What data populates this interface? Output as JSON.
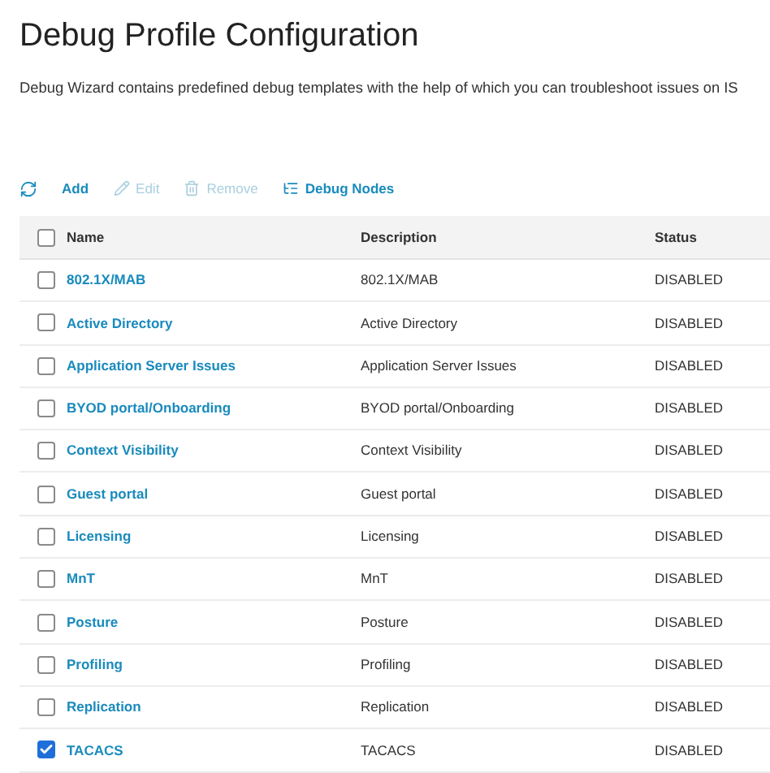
{
  "title": "Debug Profile Configuration",
  "description": "Debug Wizard contains predefined debug templates with the help of which you can troubleshoot issues on IS",
  "toolbar": [
    {
      "kind": "refresh",
      "disabled": false
    },
    {
      "kind": "add",
      "label": "Add",
      "disabled": false
    },
    {
      "kind": "edit",
      "label": "Edit",
      "disabled": true
    },
    {
      "kind": "remove",
      "label": "Remove",
      "disabled": true
    },
    {
      "kind": "nodes",
      "label": "Debug Nodes",
      "disabled": false
    }
  ],
  "table": {
    "select_all": {
      "checked": false
    },
    "columns": [
      "Name",
      "Description",
      "Status"
    ],
    "rows": [
      {
        "name": "802.1X/MAB",
        "description": "802.1X/MAB",
        "status": "DISABLED",
        "checked": false
      },
      {
        "name": "Active Directory",
        "description": "Active Directory",
        "status": "DISABLED",
        "checked": false
      },
      {
        "name": "Application Server Issues",
        "description": "Application Server Issues",
        "status": "DISABLED",
        "checked": false
      },
      {
        "name": "BYOD portal/Onboarding",
        "description": "BYOD portal/Onboarding",
        "status": "DISABLED",
        "checked": false
      },
      {
        "name": "Context Visibility",
        "description": "Context Visibility",
        "status": "DISABLED",
        "checked": false
      },
      {
        "name": "Guest portal",
        "description": "Guest portal",
        "status": "DISABLED",
        "checked": false
      },
      {
        "name": "Licensing",
        "description": "Licensing",
        "status": "DISABLED",
        "checked": false
      },
      {
        "name": "MnT",
        "description": "MnT",
        "status": "DISABLED",
        "checked": false
      },
      {
        "name": "Posture",
        "description": "Posture",
        "status": "DISABLED",
        "checked": false
      },
      {
        "name": "Profiling",
        "description": "Profiling",
        "status": "DISABLED",
        "checked": false
      },
      {
        "name": "Replication",
        "description": "Replication",
        "status": "DISABLED",
        "checked": false
      },
      {
        "name": "TACACS",
        "description": "TACACS",
        "status": "DISABLED",
        "checked": true
      }
    ]
  }
}
